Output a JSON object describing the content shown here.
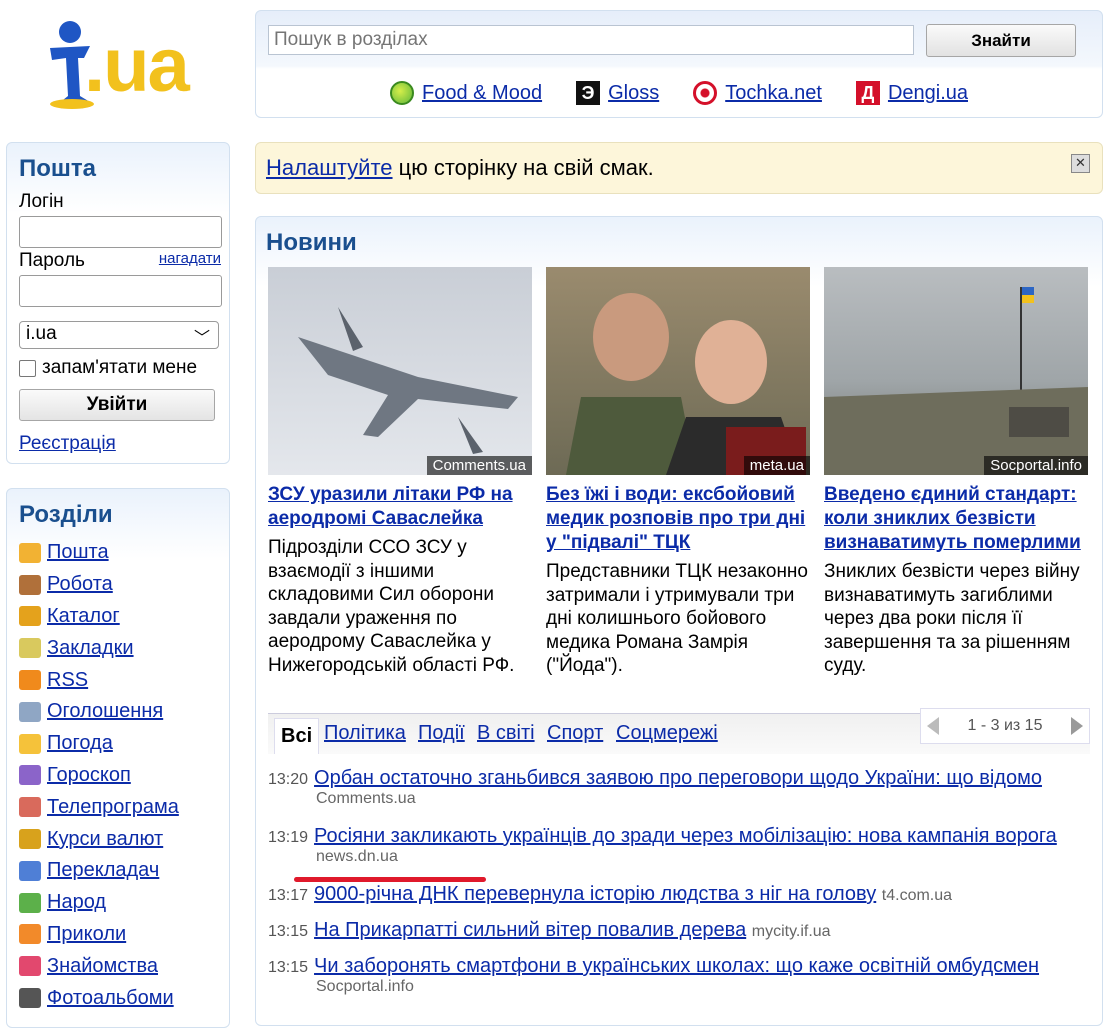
{
  "logo": {
    "text": ".ua"
  },
  "search": {
    "placeholder": "Пошук в розділах",
    "button": "Знайти"
  },
  "partners": [
    {
      "label": "Food & Mood",
      "icon": "food-mood-icon",
      "color": "#5fb83b"
    },
    {
      "label": "Gloss",
      "icon": "gloss-icon",
      "color": "#111111"
    },
    {
      "label": "Tochka.net",
      "icon": "tochka-icon",
      "color": "#d4102a"
    },
    {
      "label": "Dengi.ua",
      "icon": "dengi-icon",
      "color": "#d4102a"
    }
  ],
  "banner": {
    "link": "Налаштуйте",
    "text": " цю сторінку на свій смак."
  },
  "mail": {
    "title": "Пошта",
    "login_label": "Логін",
    "password_label": "Пароль",
    "remind": "нагадати",
    "domain": "i.ua",
    "remember": "запам'ятати мене",
    "login_button": "Увійти",
    "register": "Реєстрація"
  },
  "sections": {
    "title": "Розділи",
    "items": [
      {
        "label": "Пошта",
        "icon": "mail-icon",
        "color": "#f2b233"
      },
      {
        "label": "Робота",
        "icon": "briefcase-icon",
        "color": "#b0703a"
      },
      {
        "label": "Каталог",
        "icon": "catalog-icon",
        "color": "#e4a21c"
      },
      {
        "label": "Закладки",
        "icon": "bookmark-icon",
        "color": "#d9c95e"
      },
      {
        "label": "RSS",
        "icon": "rss-icon",
        "color": "#f08a1c"
      },
      {
        "label": "Оголошення",
        "icon": "ads-icon",
        "color": "#8fa6c4"
      },
      {
        "label": "Погода",
        "icon": "weather-icon",
        "color": "#f5c23a"
      },
      {
        "label": "Гороскоп",
        "icon": "horoscope-icon",
        "color": "#8b64c9"
      },
      {
        "label": "Телепрограма",
        "icon": "tv-icon",
        "color": "#d96a5c"
      },
      {
        "label": "Курси валют",
        "icon": "currency-icon",
        "color": "#d8a21c"
      },
      {
        "label": "Перекладач",
        "icon": "translate-icon",
        "color": "#4f7fd6"
      },
      {
        "label": "Народ",
        "icon": "people-icon",
        "color": "#5cb04a"
      },
      {
        "label": "Приколи",
        "icon": "fun-icon",
        "color": "#f28a2a"
      },
      {
        "label": "Знайомства",
        "icon": "heart-icon",
        "color": "#e2486e"
      },
      {
        "label": "Фотоальбоми",
        "icon": "camera-icon",
        "color": "#555555"
      }
    ]
  },
  "news": {
    "title": "Новини",
    "cards": [
      {
        "source": "Comments.ua",
        "title": "ЗСУ уразили літаки РФ на аеродромі Саваслейка",
        "desc": "Підрозділи ССО ЗСУ у взаємодії з іншими складовими Сил оборони завдали ураження по аеродрому Саваслейка у Нижегородській області РФ."
      },
      {
        "source": "meta.ua",
        "title": "Без їжі і води: ексбойовий медик розповів про три дні у \"підвалі\" ТЦК",
        "desc": "Представники ТЦК незаконно затримали і утримували три дні колишнього бойового медика Романа Замрія (\"Йода\")."
      },
      {
        "source": "Socportal.info",
        "title": "Введено єдиний стандарт: коли зниклих безвісти визнаватимуть померлими",
        "desc": "Зниклих безвісти через війну визнаватимуть загиблими через два роки після її завершення та за рішенням суду."
      }
    ],
    "tabs": [
      "Всі",
      "Політика",
      "Події",
      "В світі",
      "Спорт",
      "Соцмережі"
    ],
    "pager": "1 - 3 из 15",
    "items": [
      {
        "time": "13:20",
        "title": "Орбан остаточно зганьбився заявою про переговори щодо України: що відомо",
        "source": "Comments.ua"
      },
      {
        "time": "13:19",
        "title": "Росіяни закликають українців до зради через мобілізацію: нова кампанія ворога",
        "source": "news.dn.ua"
      },
      {
        "time": "13:17",
        "title": "9000-річна ДНК перевернула історію людства з ніг на голову",
        "source": "t4.com.ua"
      },
      {
        "time": "13:15",
        "title": "На Прикарпатті сильний вітер повалив дерева",
        "source": "mycity.if.ua"
      },
      {
        "time": "13:15",
        "title": "Чи заборонять смартфони в українських школах: що каже освітній омбудсмен",
        "source": "Socportal.info"
      }
    ]
  }
}
